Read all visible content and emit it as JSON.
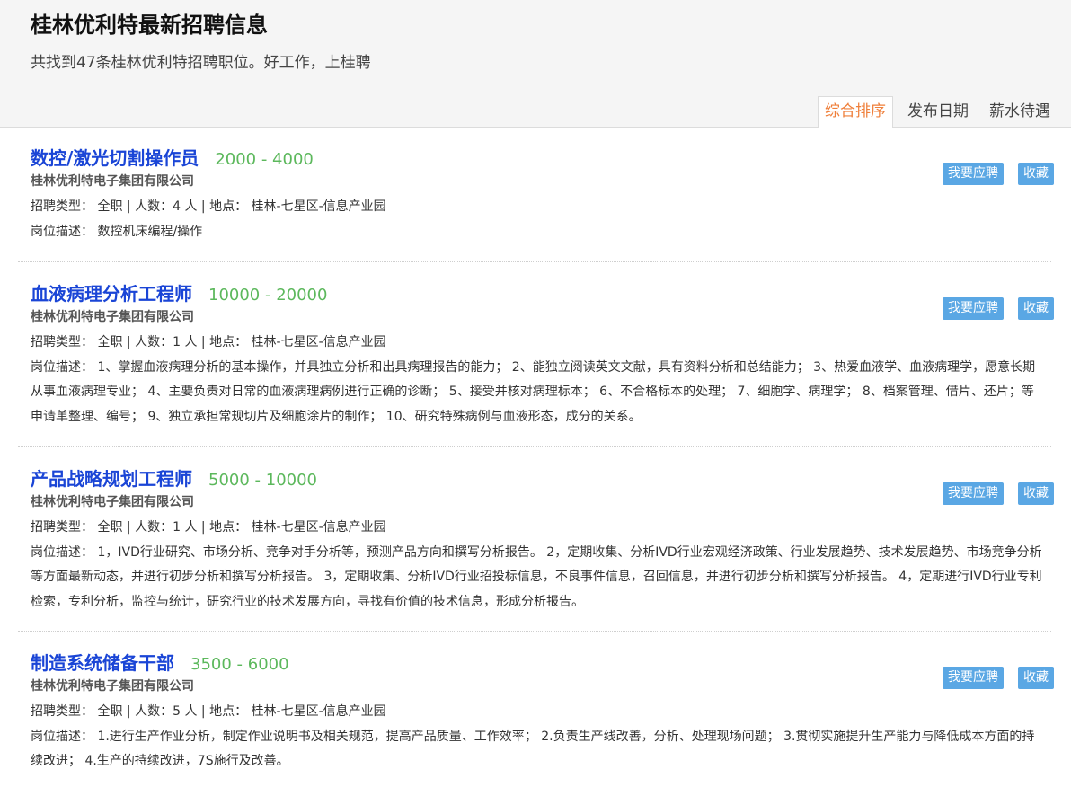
{
  "header": {
    "title": "桂林优利特最新招聘信息",
    "subtitle": "共找到47条桂林优利特招聘职位。好工作，上桂聘"
  },
  "sort_tabs": [
    {
      "label": "综合排序",
      "active": true
    },
    {
      "label": "发布日期",
      "active": false
    },
    {
      "label": "薪水待遇",
      "active": false
    }
  ],
  "labels": {
    "type_label": "招聘类型：",
    "count_label": "人数：",
    "count_unit": "人",
    "location_label": "地点：",
    "desc_label": "岗位描述：",
    "sep": "|"
  },
  "actions": {
    "apply": "我要应聘",
    "favorite": "收藏"
  },
  "jobs": [
    {
      "title": "数控/激光切割操作员",
      "salary": "2000 - 4000",
      "company": "桂林优利特电子集团有限公司",
      "type": "全职",
      "count": "4",
      "location": "桂林-七星区-信息产业园",
      "description": "数控机床编程/操作"
    },
    {
      "title": "血液病理分析工程师",
      "salary": "10000 - 20000",
      "company": "桂林优利特电子集团有限公司",
      "type": "全职",
      "count": "1",
      "location": "桂林-七星区-信息产业园",
      "description": "1、掌握血液病理分析的基本操作，并具独立分析和出具病理报告的能力； 2、能独立阅读英文文献，具有资料分析和总结能力； 3、热爱血液学、血液病理学，愿意长期从事血液病理专业； 4、主要负责对日常的血液病理病例进行正确的诊断； 5、接受并核对病理标本； 6、不合格标本的处理； 7、细胞学、病理学； 8、档案管理、借片、还片；等申请单整理、编号； 9、独立承担常规切片及细胞涂片的制作； 10、研究特殊病例与血液形态，成分的关系。"
    },
    {
      "title": "产品战略规划工程师",
      "salary": "5000 - 10000",
      "company": "桂林优利特电子集团有限公司",
      "type": "全职",
      "count": "1",
      "location": "桂林-七星区-信息产业园",
      "description": "1，IVD行业研究、市场分析、竞争对手分析等，预测产品方向和撰写分析报告。 2，定期收集、分析IVD行业宏观经济政策、行业发展趋势、技术发展趋势、市场竞争分析等方面最新动态，并进行初步分析和撰写分析报告。 3，定期收集、分析IVD行业招投标信息，不良事件信息，召回信息，并进行初步分析和撰写分析报告。 4，定期进行IVD行业专利检索，专利分析，监控与统计，研究行业的技术发展方向，寻找有价值的技术信息，形成分析报告。"
    },
    {
      "title": "制造系统储备干部",
      "salary": "3500 - 6000",
      "company": "桂林优利特电子集团有限公司",
      "type": "全职",
      "count": "5",
      "location": "桂林-七星区-信息产业园",
      "description": "1.进行生产作业分析，制定作业说明书及相关规范，提高产品质量、工作效率； 2.负责生产线改善，分析、处理现场问题； 3.贯彻实施提升生产能力与降低成本方面的持续改进； 4.生产的持续改进，7S施行及改善。"
    }
  ]
}
